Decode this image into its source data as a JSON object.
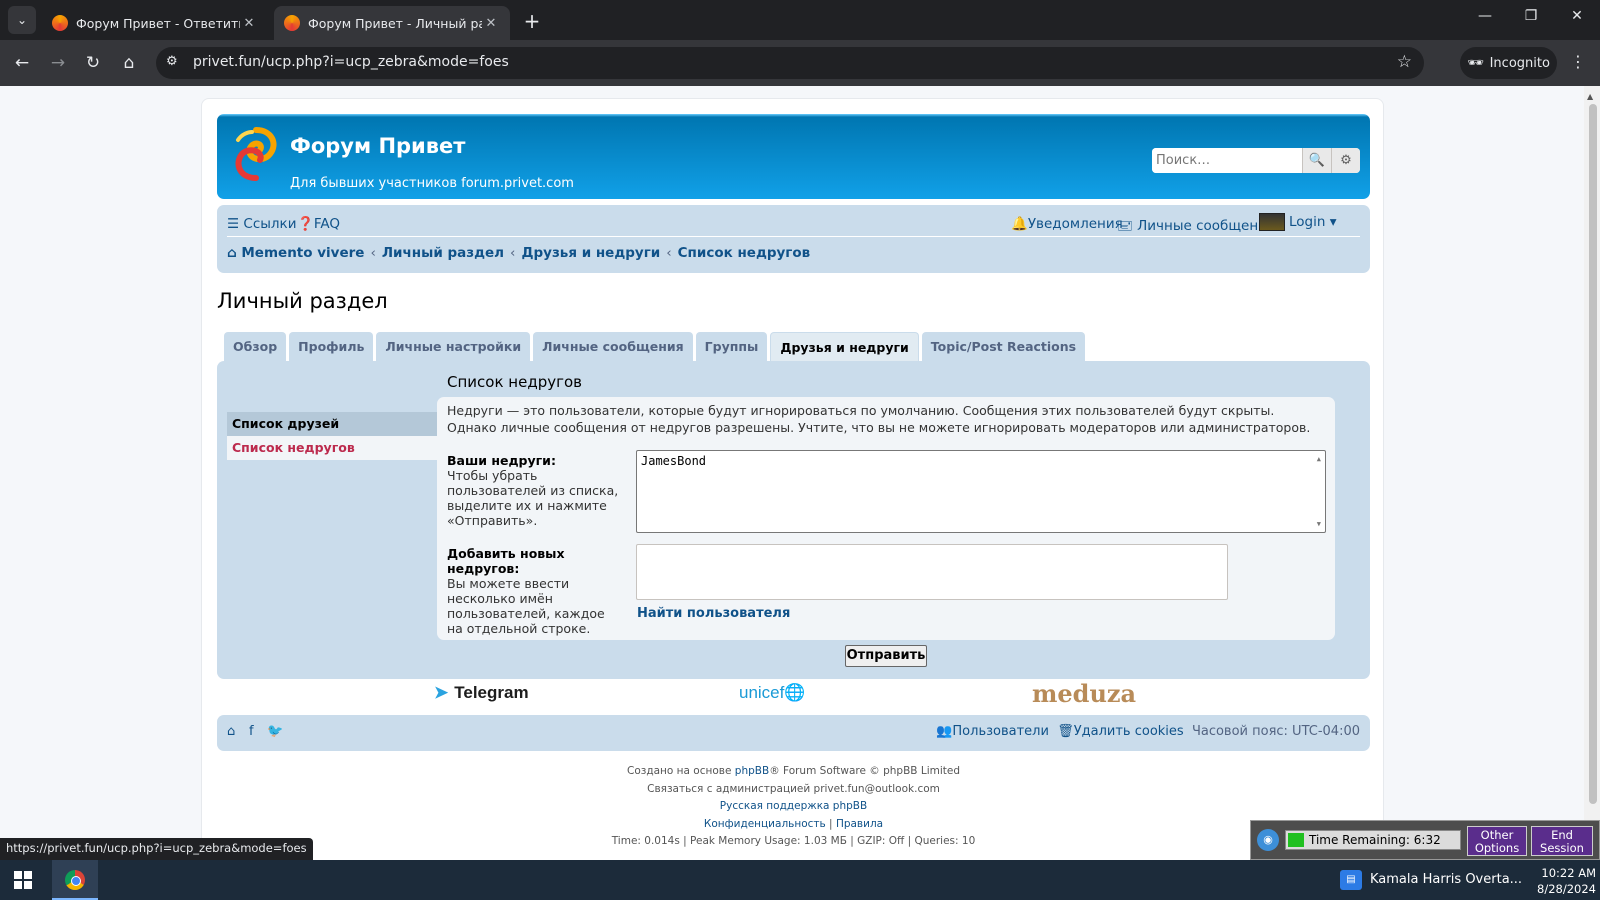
{
  "browser": {
    "tabs": [
      {
        "title": "Форум Привет - Ответить",
        "active": false
      },
      {
        "title": "Форум Привет - Личный разд",
        "active": true
      }
    ],
    "url": "privet.fun/ucp.php?i=ucp_zebra&mode=foes",
    "incognito_label": "Incognito",
    "status_url": "https://privet.fun/ucp.php?i=ucp_zebra&mode=foes"
  },
  "header": {
    "site_title": "Форум Привет",
    "site_desc": "Для бывших участников forum.privet.com",
    "search_placeholder": "Поиск…"
  },
  "nav": {
    "links": "Ссылки",
    "faq": "FAQ",
    "notifications": "Уведомления",
    "pm": "Личные сообщения",
    "login": "Login",
    "breadcrumbs": [
      "Memento vivere",
      "Личный раздел",
      "Друзья и недруги",
      "Список недругов"
    ]
  },
  "page_title": "Личный раздел",
  "tabs": [
    "Обзор",
    "Профиль",
    "Личные настройки",
    "Личные сообщения",
    "Группы",
    "Друзья и недруги",
    "Topic/Post Reactions"
  ],
  "active_tab": "Друзья и недруги",
  "subnav": [
    "Список друзей",
    "Список недругов"
  ],
  "panel": {
    "title": "Список недругов",
    "description": "Недруги — это пользователи, которые будут игнорироваться по умолчанию. Сообщения этих пользователей будут скрыты. Однако личные сообщения от недругов разрешены. Учтите, что вы не можете игнорировать модераторов или администраторов.",
    "your_foes_label": "Ваши недруги:",
    "your_foes_help": "Чтобы убрать пользователей из списка, выделите их и нажмите «Отправить».",
    "foes": [
      "JamesBond"
    ],
    "add_foes_label": "Добавить новых недругов:",
    "add_foes_help": "Вы можете ввести несколько имён пользователей, каждое на отдельной строке.",
    "find_user": "Найти пользователя",
    "submit": "Отправить"
  },
  "sponsors": {
    "telegram": "Telegram",
    "unicef": "unicef",
    "meduza": "meduza"
  },
  "footer": {
    "members": "Пользователи",
    "delete_cookies": "Удалить cookies",
    "timezone": "Часовой пояс: UTC-04:00",
    "powered_pre": "Создано на основе ",
    "phpbb": "phpBB",
    "powered_post": "® Forum Software © phpBB Limited",
    "contact": "Связаться с администрацией privet.fun@outlook.com",
    "ru_support": "Русская поддержка phpBB",
    "privacy": "Конфиденциальность",
    "rules": "Правила",
    "stats": "Time: 0.014s | Peak Memory Usage: 1.03 МБ | GZIP: Off | Queries: 10"
  },
  "session": {
    "time_remaining": "Time Remaining: 6:32",
    "other_options": "Other Options",
    "end_session": "End Session"
  },
  "taskbar": {
    "news": "Kamala Harris Overta...",
    "time": "10:22 AM",
    "date": "8/28/2024"
  },
  "colors": {
    "link": "#105289",
    "header_blue": "#12a3eb",
    "nav_bg": "#cadceb",
    "active_sub": "#bc2a4d"
  }
}
